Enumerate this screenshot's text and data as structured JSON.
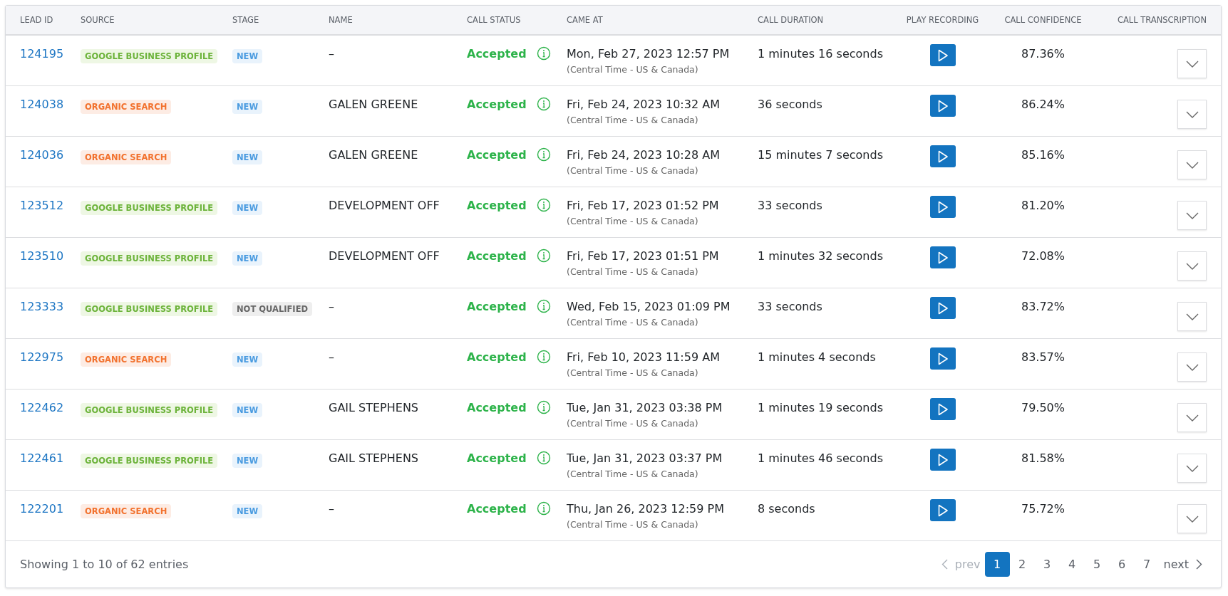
{
  "table": {
    "columns": [
      "LEAD ID",
      "SOURCE",
      "STAGE",
      "NAME",
      "CALL STATUS",
      "CAME AT",
      "CALL DURATION",
      "PLAY RECORDING",
      "CALL CONFIDENCE",
      "CALL TRANSCRIPTION"
    ],
    "rows": [
      {
        "lead_id": "124195",
        "source": {
          "label": "GOOGLE BUSINESS PROFILE",
          "kind": "google"
        },
        "stage": {
          "label": "NEW",
          "kind": "new"
        },
        "name": "–",
        "call_status": "Accepted",
        "came_at": "Mon, Feb 27, 2023 12:57 PM",
        "timezone": "(Central Time - US & Canada)",
        "duration": "1 minutes 16 seconds",
        "confidence": "87.36%",
        "expanded": false
      },
      {
        "lead_id": "124038",
        "source": {
          "label": "ORGANIC SEARCH",
          "kind": "organic"
        },
        "stage": {
          "label": "NEW",
          "kind": "new"
        },
        "name": "GALEN GREENE",
        "call_status": "Accepted",
        "came_at": "Fri, Feb 24, 2023 10:32 AM",
        "timezone": "(Central Time - US & Canada)",
        "duration": "36 seconds",
        "confidence": "86.24%",
        "expanded": false
      },
      {
        "lead_id": "124036",
        "source": {
          "label": "ORGANIC SEARCH",
          "kind": "organic"
        },
        "stage": {
          "label": "NEW",
          "kind": "new"
        },
        "name": "GALEN GREENE",
        "call_status": "Accepted",
        "came_at": "Fri, Feb 24, 2023 10:28 AM",
        "timezone": "(Central Time - US & Canada)",
        "duration": "15 minutes 7 seconds",
        "confidence": "85.16%",
        "expanded": false
      },
      {
        "lead_id": "123512",
        "source": {
          "label": "GOOGLE BUSINESS PROFILE",
          "kind": "google"
        },
        "stage": {
          "label": "NEW",
          "kind": "new"
        },
        "name": "DEVELOPMENT OFF",
        "call_status": "Accepted",
        "came_at": "Fri, Feb 17, 2023 01:52 PM",
        "timezone": "(Central Time - US & Canada)",
        "duration": "33 seconds",
        "confidence": "81.20%",
        "expanded": false
      },
      {
        "lead_id": "123510",
        "source": {
          "label": "GOOGLE BUSINESS PROFILE",
          "kind": "google"
        },
        "stage": {
          "label": "NEW",
          "kind": "new"
        },
        "name": "DEVELOPMENT OFF",
        "call_status": "Accepted",
        "came_at": "Fri, Feb 17, 2023 01:51 PM",
        "timezone": "(Central Time - US & Canada)",
        "duration": "1 minutes 32 seconds",
        "confidence": "72.08%",
        "expanded": false
      },
      {
        "lead_id": "123333",
        "source": {
          "label": "GOOGLE BUSINESS PROFILE",
          "kind": "google"
        },
        "stage": {
          "label": "NOT QUALIFIED",
          "kind": "not_qualified"
        },
        "name": "–",
        "call_status": "Accepted",
        "came_at": "Wed, Feb 15, 2023 01:09 PM",
        "timezone": "(Central Time - US & Canada)",
        "duration": "33 seconds",
        "confidence": "83.72%",
        "expanded": false
      },
      {
        "lead_id": "122975",
        "source": {
          "label": "ORGANIC SEARCH",
          "kind": "organic"
        },
        "stage": {
          "label": "NEW",
          "kind": "new"
        },
        "name": "–",
        "call_status": "Accepted",
        "came_at": "Fri, Feb 10, 2023 11:59 AM",
        "timezone": "(Central Time - US & Canada)",
        "duration": "1 minutes 4 seconds",
        "confidence": "83.57%",
        "expanded": false
      },
      {
        "lead_id": "122462",
        "source": {
          "label": "GOOGLE BUSINESS PROFILE",
          "kind": "google"
        },
        "stage": {
          "label": "NEW",
          "kind": "new"
        },
        "name": "GAIL STEPHENS",
        "call_status": "Accepted",
        "came_at": "Tue, Jan 31, 2023 03:38 PM",
        "timezone": "(Central Time - US & Canada)",
        "duration": "1 minutes 19 seconds",
        "confidence": "79.50%",
        "expanded": false
      },
      {
        "lead_id": "122461",
        "source": {
          "label": "GOOGLE BUSINESS PROFILE",
          "kind": "google"
        },
        "stage": {
          "label": "NEW",
          "kind": "new"
        },
        "name": "GAIL STEPHENS",
        "call_status": "Accepted",
        "came_at": "Tue, Jan 31, 2023 03:37 PM",
        "timezone": "(Central Time - US & Canada)",
        "duration": "1 minutes 46 seconds",
        "confidence": "81.58%",
        "expanded": false
      },
      {
        "lead_id": "122201",
        "source": {
          "label": "ORGANIC SEARCH",
          "kind": "organic"
        },
        "stage": {
          "label": "NEW",
          "kind": "new"
        },
        "name": "–",
        "call_status": "Accepted",
        "came_at": "Thu, Jan 26, 2023 12:59 PM",
        "timezone": "(Central Time - US & Canada)",
        "duration": "8 seconds",
        "confidence": "75.72%",
        "expanded": false
      }
    ]
  },
  "footer": {
    "summary": "Showing 1 to 10 of 62 entries",
    "pagination": {
      "prev": {
        "label": "prev",
        "disabled": true
      },
      "pages": [
        {
          "label": "1",
          "selected": true
        },
        {
          "label": "2",
          "selected": false
        },
        {
          "label": "3",
          "selected": false
        },
        {
          "label": "4",
          "selected": false
        },
        {
          "label": "5",
          "selected": false
        },
        {
          "label": "6",
          "selected": false
        },
        {
          "label": "7",
          "selected": false
        }
      ],
      "next": {
        "label": "next",
        "disabled": false
      }
    }
  }
}
